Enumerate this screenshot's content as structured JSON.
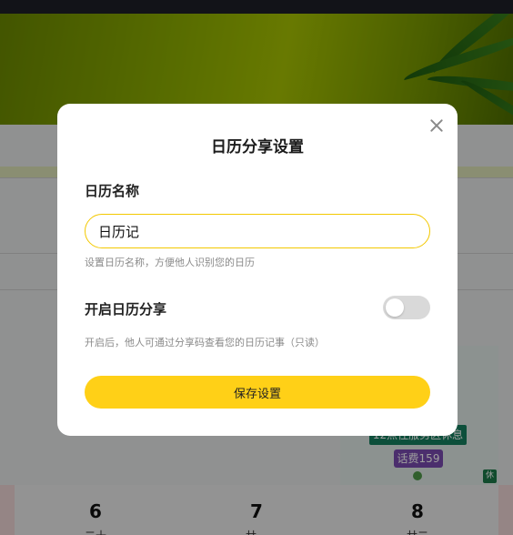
{
  "background": {
    "days": [
      {
        "num": "6",
        "sub": "二十"
      },
      {
        "num": "7",
        "sub": "廿一"
      },
      {
        "num": "8",
        "sub": "廿二"
      }
    ],
    "event_badge": "12点往服务区休息",
    "fee_badge": "话费159",
    "rest_tag": "休"
  },
  "modal": {
    "title": "日历分享设置",
    "name_label": "日历名称",
    "name_value": "日历记",
    "name_hint": "设置日历名称，方便他人识别您的日历",
    "share_label": "开启日历分享",
    "share_enabled": false,
    "share_hint": "开启后，他人可通过分享码查看您的日历记事（只读）",
    "save_label": "保存设置"
  },
  "colors": {
    "accent": "#ffd017",
    "input_border": "#f3c800",
    "toggle_off": "#d9d9d9"
  },
  "icons": {
    "close": "close-icon"
  }
}
